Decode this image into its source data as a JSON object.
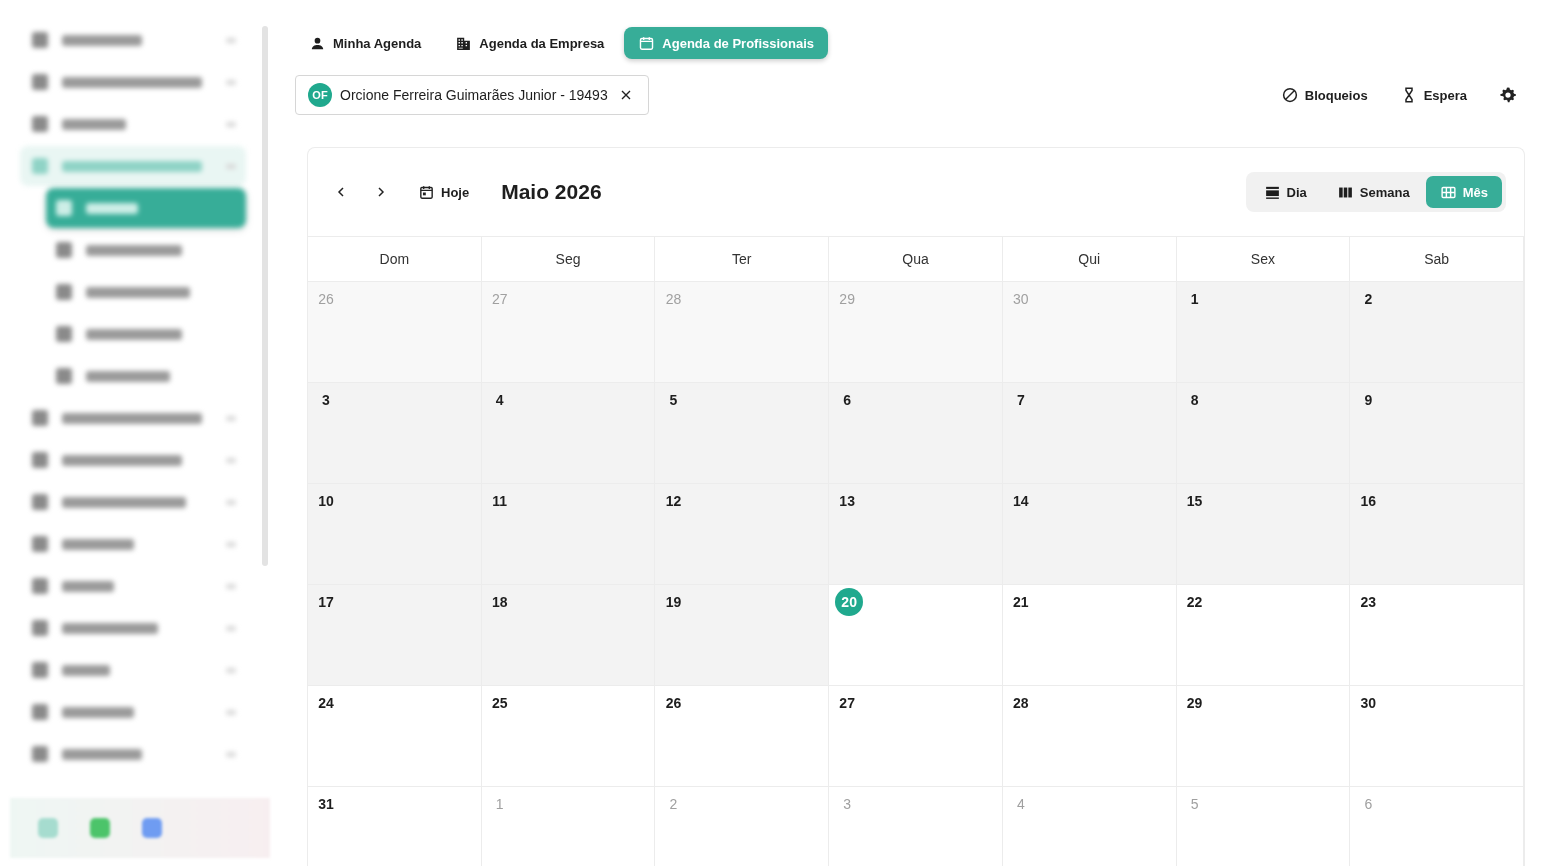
{
  "sidebar": {
    "items": [
      {
        "kind": "group",
        "selected": false
      },
      {
        "kind": "group",
        "selected": false
      },
      {
        "kind": "group",
        "selected": false
      },
      {
        "kind": "group",
        "selected": true
      },
      {
        "kind": "sub",
        "selected": true
      },
      {
        "kind": "sub",
        "selected": false
      },
      {
        "kind": "sub",
        "selected": false
      },
      {
        "kind": "sub",
        "selected": false
      },
      {
        "kind": "sub",
        "selected": false
      },
      {
        "kind": "group",
        "selected": false
      },
      {
        "kind": "group",
        "selected": false
      },
      {
        "kind": "group",
        "selected": false
      },
      {
        "kind": "group",
        "selected": false
      },
      {
        "kind": "group",
        "selected": false
      },
      {
        "kind": "group",
        "selected": false
      },
      {
        "kind": "group",
        "selected": false
      },
      {
        "kind": "group",
        "selected": false
      },
      {
        "kind": "group",
        "selected": false
      }
    ]
  },
  "tabs": [
    {
      "label": "Minha Agenda",
      "kind": "person",
      "selected": false
    },
    {
      "label": "Agenda da Empresa",
      "kind": "building",
      "selected": false
    },
    {
      "label": "Agenda de Profissionais",
      "kind": "calendar",
      "selected": true
    }
  ],
  "professional_chip": {
    "initials": "OF",
    "label": "Orcione Ferreira Guimarães Junior - 19493"
  },
  "actions": [
    {
      "label": "Bloqueios",
      "kind": "block"
    },
    {
      "label": "Espera",
      "kind": "hourglass"
    },
    {
      "kind": "settings"
    }
  ],
  "calendar": {
    "today_button": "Hoje",
    "title": "Maio 2026",
    "views": [
      {
        "label": "Dia",
        "kind": "day",
        "selected": false
      },
      {
        "label": "Semana",
        "kind": "week",
        "selected": false
      },
      {
        "label": "Mês",
        "kind": "month",
        "selected": true
      }
    ],
    "weekdays": [
      "Dom",
      "Seg",
      "Ter",
      "Qua",
      "Qui",
      "Sex",
      "Sab"
    ],
    "weeks": [
      [
        {
          "day": "26",
          "outside": true,
          "past": true,
          "today": false
        },
        {
          "day": "27",
          "outside": true,
          "past": true,
          "today": false
        },
        {
          "day": "28",
          "outside": true,
          "past": true,
          "today": false
        },
        {
          "day": "29",
          "outside": true,
          "past": true,
          "today": false
        },
        {
          "day": "30",
          "outside": true,
          "past": true,
          "today": false
        },
        {
          "day": "1",
          "outside": false,
          "past": true,
          "today": false
        },
        {
          "day": "2",
          "outside": false,
          "past": true,
          "today": false
        }
      ],
      [
        {
          "day": "3",
          "outside": false,
          "past": true,
          "today": false
        },
        {
          "day": "4",
          "outside": false,
          "past": true,
          "today": false
        },
        {
          "day": "5",
          "outside": false,
          "past": true,
          "today": false
        },
        {
          "day": "6",
          "outside": false,
          "past": true,
          "today": false
        },
        {
          "day": "7",
          "outside": false,
          "past": true,
          "today": false
        },
        {
          "day": "8",
          "outside": false,
          "past": true,
          "today": false
        },
        {
          "day": "9",
          "outside": false,
          "past": true,
          "today": false
        }
      ],
      [
        {
          "day": "10",
          "outside": false,
          "past": true,
          "today": false
        },
        {
          "day": "11",
          "outside": false,
          "past": true,
          "today": false
        },
        {
          "day": "12",
          "outside": false,
          "past": true,
          "today": false
        },
        {
          "day": "13",
          "outside": false,
          "past": true,
          "today": false
        },
        {
          "day": "14",
          "outside": false,
          "past": true,
          "today": false
        },
        {
          "day": "15",
          "outside": false,
          "past": true,
          "today": false
        },
        {
          "day": "16",
          "outside": false,
          "past": true,
          "today": false
        }
      ],
      [
        {
          "day": "17",
          "outside": false,
          "past": true,
          "today": false
        },
        {
          "day": "18",
          "outside": false,
          "past": true,
          "today": false
        },
        {
          "day": "19",
          "outside": false,
          "past": true,
          "today": false
        },
        {
          "day": "20",
          "outside": false,
          "past": false,
          "today": true
        },
        {
          "day": "21",
          "outside": false,
          "past": false,
          "today": false
        },
        {
          "day": "22",
          "outside": false,
          "past": false,
          "today": false
        },
        {
          "day": "23",
          "outside": false,
          "past": false,
          "today": false
        }
      ],
      [
        {
          "day": "24",
          "outside": false,
          "past": false,
          "today": false
        },
        {
          "day": "25",
          "outside": false,
          "past": false,
          "today": false
        },
        {
          "day": "26",
          "outside": false,
          "past": false,
          "today": false
        },
        {
          "day": "27",
          "outside": false,
          "past": false,
          "today": false
        },
        {
          "day": "28",
          "outside": false,
          "past": false,
          "today": false
        },
        {
          "day": "29",
          "outside": false,
          "past": false,
          "today": false
        },
        {
          "day": "30",
          "outside": false,
          "past": false,
          "today": false
        }
      ],
      [
        {
          "day": "31",
          "outside": false,
          "past": false,
          "today": false
        },
        {
          "day": "1",
          "outside": true,
          "past": false,
          "today": false
        },
        {
          "day": "2",
          "outside": true,
          "past": false,
          "today": false
        },
        {
          "day": "3",
          "outside": true,
          "past": false,
          "today": false
        },
        {
          "day": "4",
          "outside": true,
          "past": false,
          "today": false
        },
        {
          "day": "5",
          "outside": true,
          "past": false,
          "today": false
        },
        {
          "day": "6",
          "outside": true,
          "past": false,
          "today": false
        }
      ]
    ]
  }
}
